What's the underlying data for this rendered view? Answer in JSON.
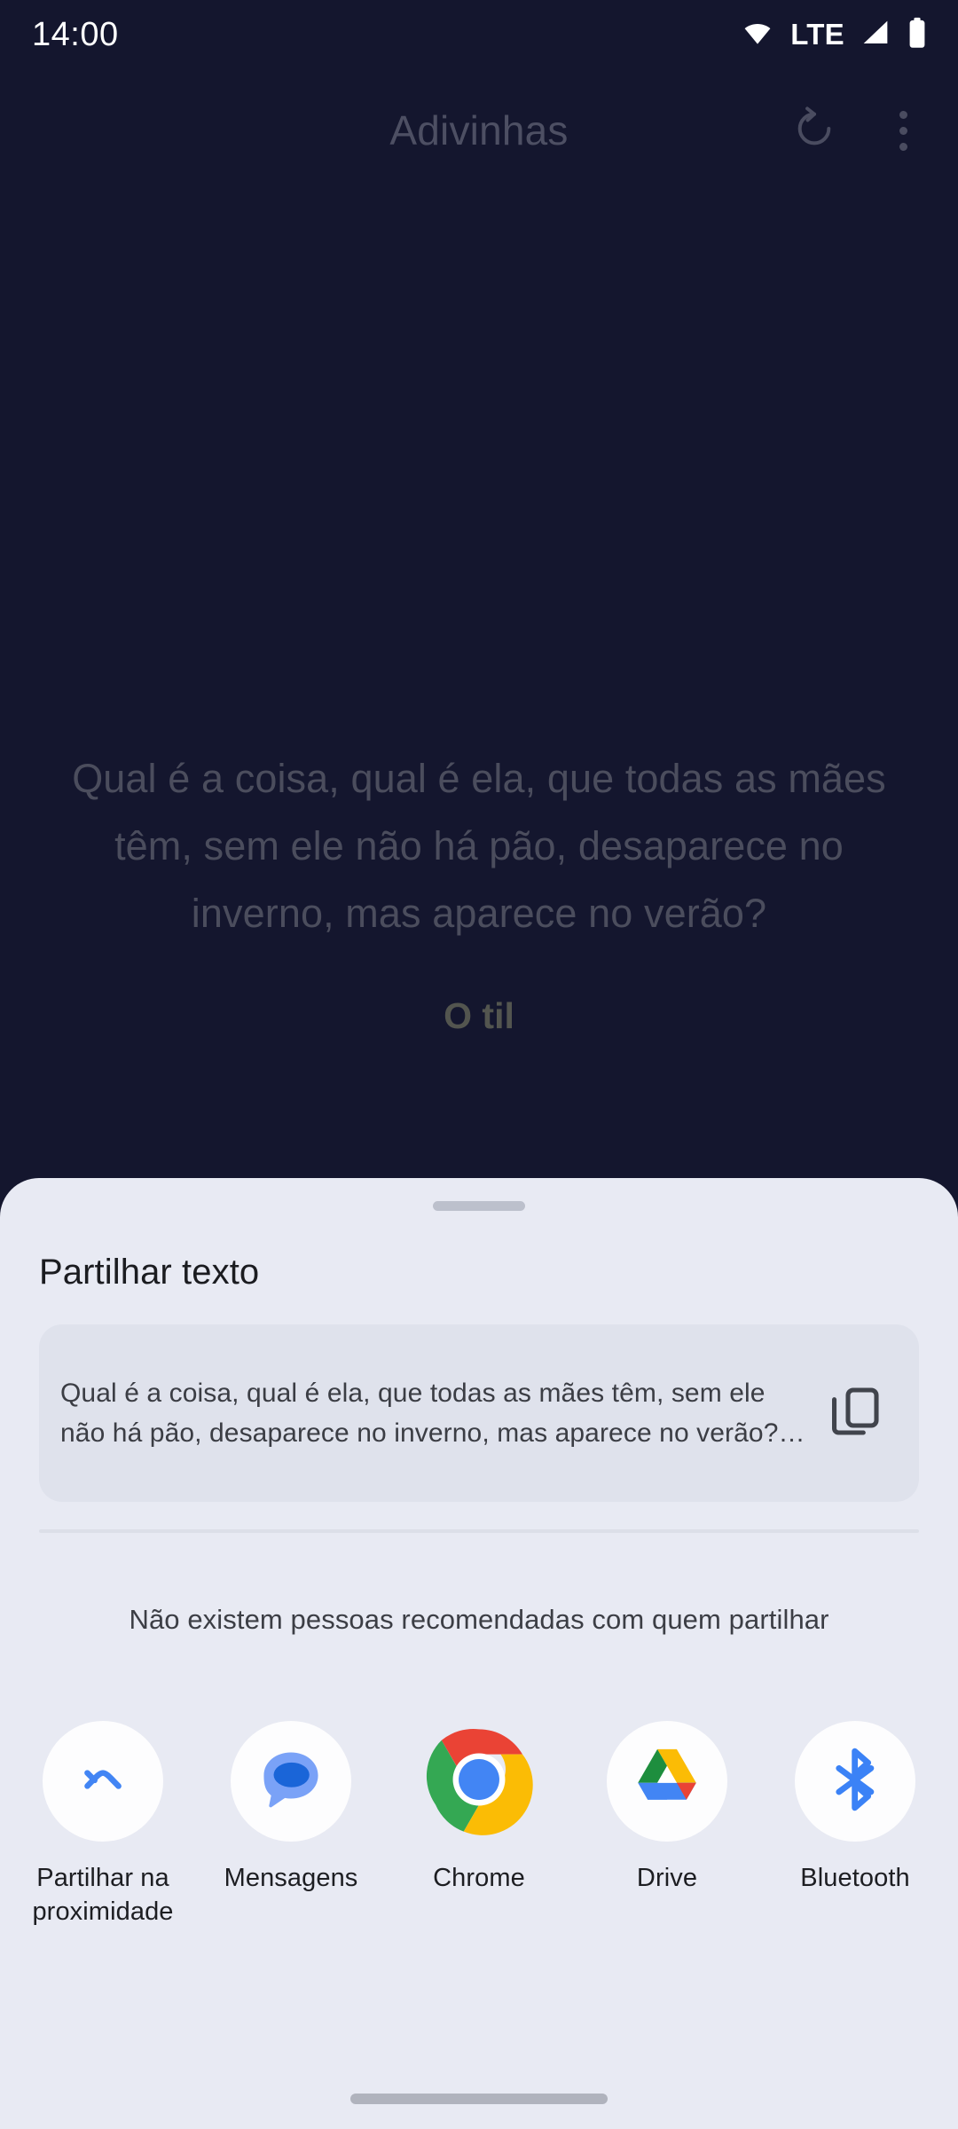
{
  "status_bar": {
    "clock": "14:00",
    "network_label": "LTE",
    "icons": [
      "wifi-icon",
      "signal-icon",
      "battery-icon"
    ]
  },
  "app_header": {
    "title": "Adivinhas",
    "refresh_icon": "refresh-icon",
    "overflow_icon": "overflow-menu-icon"
  },
  "riddle": {
    "question": "Qual é a coisa, qual é ela, que todas as mães têm, sem ele não há pão, desaparece no inverno, mas aparece no verão?",
    "answer": "O til"
  },
  "share_sheet": {
    "title": "Partilhar texto",
    "preview_text": "Qual é a coisa, qual é ela, que todas as mães têm, sem ele não há pão, desaparece no inverno, mas aparece no verão?…",
    "copy_icon": "copy-icon",
    "no_people_message": "Não existem pessoas recomendadas com quem partilhar",
    "targets": [
      {
        "label": "Partilhar na proximidade",
        "icon": "nearby-share-icon"
      },
      {
        "label": "Mensagens",
        "icon": "google-messages-icon"
      },
      {
        "label": "Chrome",
        "icon": "chrome-icon"
      },
      {
        "label": "Drive",
        "icon": "google-drive-icon"
      },
      {
        "label": "Bluetooth",
        "icon": "bluetooth-icon"
      }
    ]
  },
  "colors": {
    "app_background": "#14162e",
    "sheet_background": "#e8eaf3",
    "preview_card": "#dfe2ec",
    "accent_blue": "#4285f4",
    "chrome_red": "#ea4335",
    "chrome_yellow": "#fbbc05",
    "chrome_green": "#34a853"
  }
}
